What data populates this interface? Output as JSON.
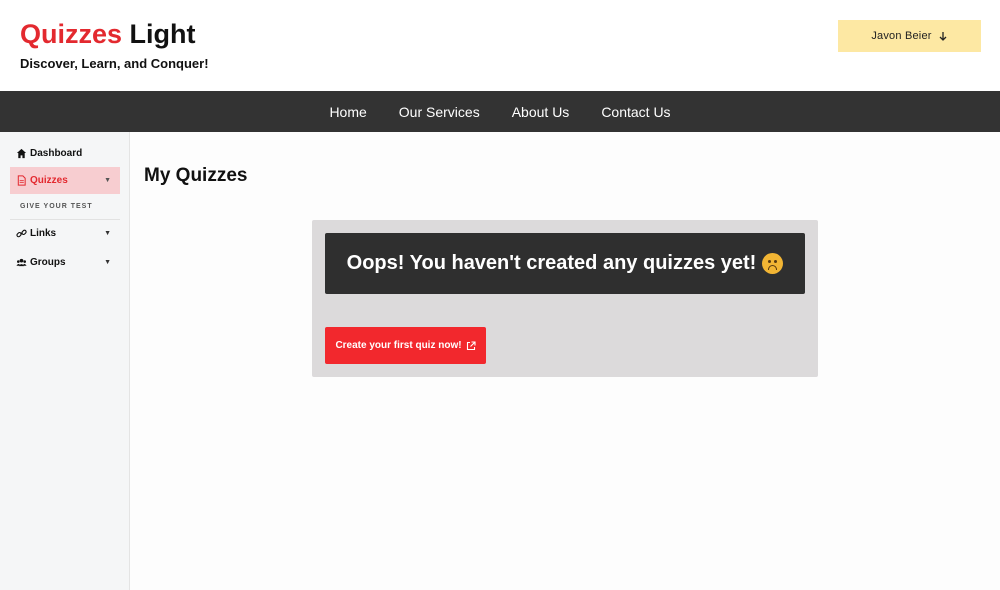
{
  "brand": {
    "title_accent": "Quizzes",
    "title_rest": "Light",
    "tagline": "Discover, Learn, and Conquer!",
    "accent_color": "#e3292f"
  },
  "user": {
    "name": "Javon Beier",
    "icon": "arrow-down-icon"
  },
  "topnav": {
    "items": [
      "Home",
      "Our Services",
      "About Us",
      "Contact Us"
    ]
  },
  "sidebar": {
    "items": [
      {
        "label": "Dashboard",
        "icon": "home-icon"
      },
      {
        "label": "Quizzes",
        "icon": "document-icon",
        "active": true
      },
      {
        "label": "Links",
        "icon": "link-icon"
      },
      {
        "label": "Groups",
        "icon": "users-icon"
      }
    ],
    "sub_label": "GIVE YOUR TEST"
  },
  "main": {
    "title": "My Quizzes",
    "empty_message": "Oops! You haven't created any quizzes yet!",
    "emoji": "frowning-face-icon",
    "create_button": "Create your first quiz now!",
    "create_icon": "external-link-icon"
  }
}
